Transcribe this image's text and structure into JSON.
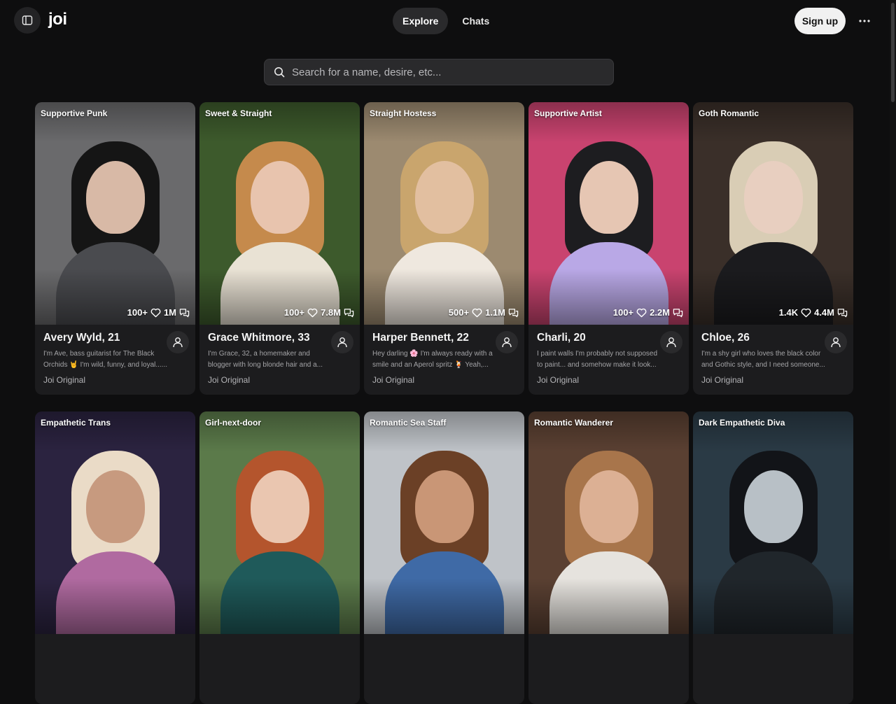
{
  "header": {
    "logo": "joi",
    "nav_tabs": [
      {
        "label": "Explore",
        "active": true
      },
      {
        "label": "Chats",
        "active": false
      }
    ],
    "signup_label": "Sign up",
    "icons": {
      "sidebar": "sidebar-toggle-icon",
      "more": "more-horizontal-icon"
    }
  },
  "search": {
    "placeholder": "Search for a name, desire, etc...",
    "icon": "search-icon"
  },
  "theme": {
    "background": "#0e0e0f",
    "card": "#1c1c1e",
    "accent_button": "#f1f1f1"
  },
  "cards": [
    {
      "tag": "Supportive Punk",
      "chats": "100+",
      "likes": "1M",
      "name": "Avery Wyld, 21",
      "description": "I'm Ave, bass guitarist for The Black Orchids 🤘 I'm wild, funny, and loyal......",
      "origin": "Joi Original",
      "palette": {
        "bg": "#6a6a6c",
        "hair": "#151515",
        "skin": "#d8b9a6",
        "body": "#4a4b4f"
      }
    },
    {
      "tag": "Sweet & Straight",
      "chats": "100+",
      "likes": "7.8M",
      "name": "Grace Whitmore, 33",
      "description": "I'm Grace, 32, a homemaker and blogger with long blonde hair and a...",
      "origin": "Joi Original",
      "palette": {
        "bg": "#3d5a2c",
        "hair": "#c58a4c",
        "skin": "#e8c4ae",
        "body": "#e9e2d4"
      }
    },
    {
      "tag": "Straight Hostess",
      "chats": "500+",
      "likes": "1.1M",
      "name": "Harper Bennett, 22",
      "description": "Hey darling 🌸 I'm always ready with a smile and an Aperol spritz 🍹 Yeah,...",
      "origin": "Joi Original",
      "palette": {
        "bg": "#9c8a70",
        "hair": "#c9a56d",
        "skin": "#e2bfa0",
        "body": "#efe8df"
      }
    },
    {
      "tag": "Supportive Artist",
      "chats": "100+",
      "likes": "2.2M",
      "name": "Charli, 20",
      "description": "I paint walls I'm probably not supposed to paint... and somehow make it look...",
      "origin": "Joi Original",
      "palette": {
        "bg": "#c9436f",
        "hair": "#1d1d20",
        "skin": "#e6c6b3",
        "body": "#b9a8e6"
      }
    },
    {
      "tag": "Goth Romantic",
      "chats": "1.4K",
      "likes": "4.4M",
      "name": "Chloe, 26",
      "description": "I'm a shy girl who loves the black color and Gothic style, and I need someone...",
      "origin": "Joi Original",
      "palette": {
        "bg": "#3a2f29",
        "hair": "#d9cdb5",
        "skin": "#e8cfc0",
        "body": "#1b1b1e"
      }
    },
    {
      "tag": "Empathetic Trans",
      "chats": "",
      "likes": "",
      "name": "",
      "description": "",
      "origin": "",
      "palette": {
        "bg": "#2b2340",
        "hair": "#eadbc7",
        "skin": "#c79a7f",
        "body": "#b06aa0"
      }
    },
    {
      "tag": "Girl-next-door",
      "chats": "",
      "likes": "",
      "name": "",
      "description": "",
      "origin": "",
      "palette": {
        "bg": "#5b7a4a",
        "hair": "#b4552d",
        "skin": "#eac6b0",
        "body": "#1f5a5a"
      }
    },
    {
      "tag": "Romantic Sea Staff",
      "chats": "",
      "likes": "",
      "name": "",
      "description": "",
      "origin": "",
      "palette": {
        "bg": "#bfc3c8",
        "hair": "#6b4026",
        "skin": "#c99676",
        "body": "#3f6aa6"
      }
    },
    {
      "tag": "Romantic Wanderer",
      "chats": "",
      "likes": "",
      "name": "",
      "description": "",
      "origin": "",
      "palette": {
        "bg": "#5a4032",
        "hair": "#a8754b",
        "skin": "#dcb094",
        "body": "#e6e3de"
      }
    },
    {
      "tag": "Dark Empathetic Diva",
      "chats": "",
      "likes": "",
      "name": "",
      "description": "",
      "origin": "",
      "palette": {
        "bg": "#2a3a45",
        "hair": "#121418",
        "skin": "#b8c0c6",
        "body": "#20262b"
      }
    }
  ]
}
